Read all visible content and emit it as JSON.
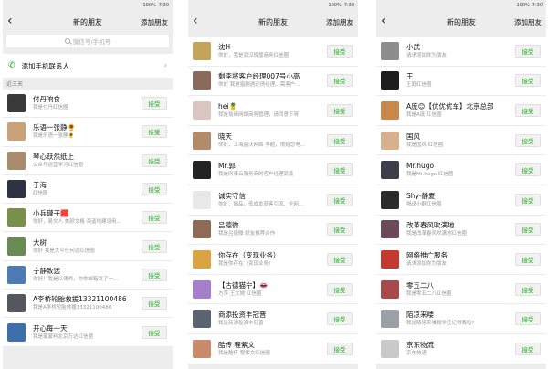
{
  "status_bar": {
    "battery": "100%",
    "time": "7:30"
  },
  "panels": [
    {
      "back_icon": "chevron-left-icon",
      "title": "新的朋友",
      "action": "添加朋友",
      "search_placeholder": "微信号/手机号",
      "add_contacts_label": "添加手机联系人",
      "section_label": "近三天",
      "accept_label": "接受",
      "rows": [
        {
          "name": "付丹响食",
          "msg": "我是付丹红信圈",
          "color": "#3a3a3a"
        },
        {
          "name": "乐语一张静🌻",
          "msg": "我是乐语一张静🌻",
          "color": "#c9a27a"
        },
        {
          "name": "琴心跃然纸上",
          "msg": "公众号运营学习红信圈",
          "color": "#a98b6d"
        },
        {
          "name": "于海",
          "msg": "红信圈",
          "color": "#2f3240"
        },
        {
          "name": "小兵瓏子🟥",
          "msg": "你好，易文人 美颜文格 海盗地建设用...",
          "color": "#7a8f4a"
        },
        {
          "name": "大树",
          "msg": "你好 我是大平任何远红信圈",
          "color": "#6a8a54"
        },
        {
          "name": "宁静致远",
          "msg": "你好！我是以律师，你你邮箱发了一...",
          "color": "#4b7ab5"
        },
        {
          "name": "A李桥轮胎救援13321100486",
          "msg": "我是A李桥轮胎救援13321100486",
          "color": "#55575e"
        },
        {
          "name": "开心每一天",
          "msg": "我是蒙蒙利北京万达红信圈",
          "color": "#3d6fa8"
        }
      ]
    },
    {
      "back_icon": "chevron-left-icon",
      "title": "新的朋友",
      "action": "添加朋友",
      "accept_label": "接受",
      "rows": [
        {
          "name": "沈H",
          "msg": "你好，我是武汉辉煌商务红信圈",
          "color": "#c4a35a"
        },
        {
          "name": "剩李将客户经理007号小高",
          "msg": "你好 我是猎剧遇还债经理，需客户...",
          "color": "#8a6a5a"
        },
        {
          "name": "hei🍍",
          "msg": "我是翁缘网络商务管理，请同意下呀",
          "color": "#d9c6c0"
        },
        {
          "name": "晓天",
          "msg": "你好，上海益沃网络 李超，很给您电...",
          "color": "#b38a6a"
        },
        {
          "name": "Mr.郭",
          "msg": "我是网事云服务商的客户经理郭鑫",
          "color": "#222222"
        },
        {
          "name": "诚实守信",
          "msg": "你好，如品，低成本获客引流、全网...",
          "color": "#e8e8e8"
        },
        {
          "name": "吕德微",
          "msg": "我是吕德微 好友推荐合作",
          "color": "#8f6b55"
        },
        {
          "name": "你存在（变现业务）",
          "msg": "我是你存在（变现业务）",
          "color": "#d9a441"
        },
        {
          "name": "【古德猫宁】👄",
          "msg": "方萍 王文她 红信圈",
          "color": "#a57fc9"
        },
        {
          "name": "商添投资丰冠晋",
          "msg": "我是商添投资丰冠晋",
          "color": "#5a6470"
        },
        {
          "name": "酷传 程紫文",
          "msg": "我是酷传 程紫文红信圈",
          "color": "#c98a6b"
        }
      ]
    },
    {
      "back_icon": "chevron-left-icon",
      "title": "新的朋友",
      "action": "添加朋友",
      "accept_label": "接受",
      "rows": [
        {
          "name": "小武",
          "msg": "请求添加你为朋友",
          "color": "#8d8d8d"
        },
        {
          "name": "王",
          "msg": "王庭红信圈",
          "color": "#1e1e1e"
        },
        {
          "name": "A庞😊【优优优车】北京总部",
          "msg": "我是A庞 红信圈",
          "color": "#c9874a"
        },
        {
          "name": "国风",
          "msg": "我是国风 红信圈",
          "color": "#d8b08c"
        },
        {
          "name": "Mr.hugo",
          "msg": "我是Mr.hugo 红信圈",
          "color": "#3c3f4a"
        },
        {
          "name": "Shy-静夏",
          "msg": "喝请小群红信圈",
          "color": "#2b2b2b"
        },
        {
          "name": "改革春风吹满地",
          "msg": "我是改革春风吹满地红信圈",
          "color": "#6b4a5a"
        },
        {
          "name": "网络推广服务",
          "msg": "请求添加你为朋友",
          "color": "#c43a2e"
        },
        {
          "name": "零五二八",
          "msg": "我是零五二八红信圈",
          "color": "#a84a4a"
        },
        {
          "name": "陌凉来喽",
          "msg": "我是陌凉来喽我学还记得我吗?",
          "color": "#9aa0a6"
        },
        {
          "name": "京东物流",
          "msg": "京东快递",
          "color": "#c9c9c9"
        }
      ]
    }
  ]
}
